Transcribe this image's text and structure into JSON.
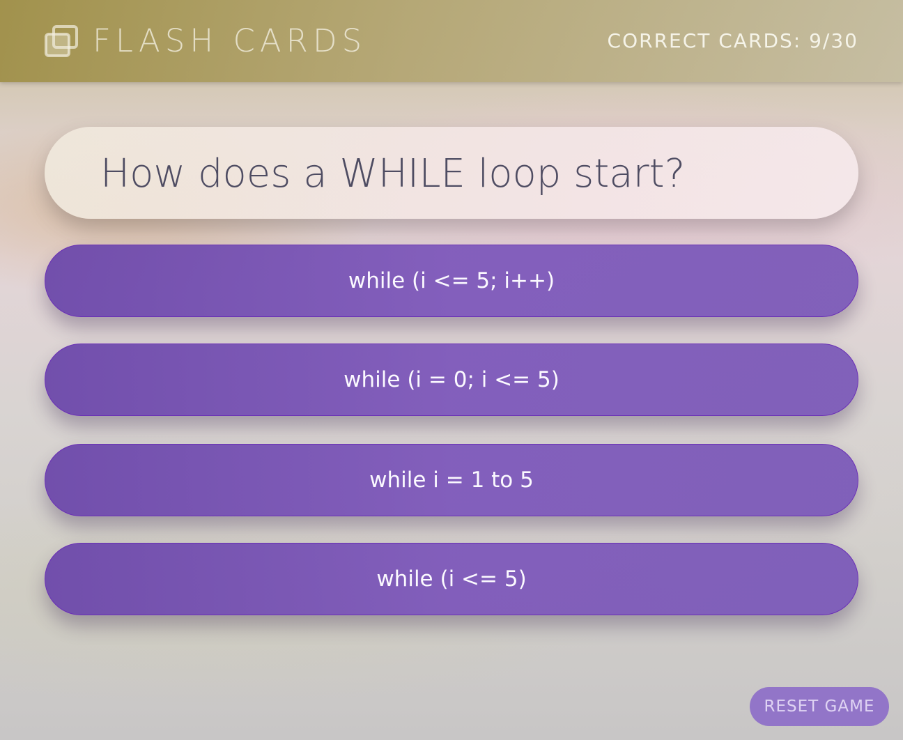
{
  "header": {
    "title": "FLASH CARDS",
    "logo_icon": "stacked-cards-icon",
    "score_text": "CORRECT CARDS: 9/30"
  },
  "question": {
    "text": "How does a WHILE loop start?"
  },
  "answers": [
    {
      "label": "while (i <= 5; i++)"
    },
    {
      "label": "while (i = 0; i <= 5)"
    },
    {
      "label": "while i = 1 to 5"
    },
    {
      "label": "while (i <= 5)"
    }
  ],
  "footer": {
    "reset_label": "RESET GAME"
  },
  "colors": {
    "answer_fill": "#7656b8",
    "answer_border": "#6a2fb6",
    "question_text": "#4e4c62",
    "header_bar": "#a8995a"
  }
}
